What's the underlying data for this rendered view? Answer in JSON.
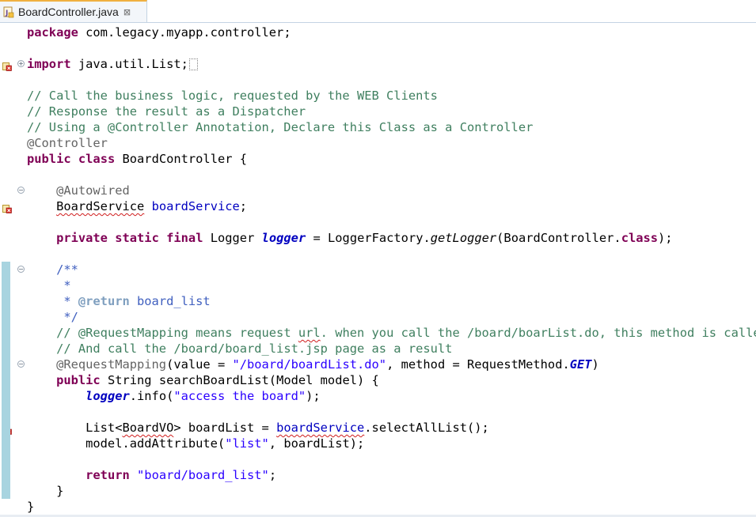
{
  "editor": {
    "tab": {
      "label": "BoardController.java",
      "close_glyph": "⊠",
      "icon": "java-file-warning-icon"
    },
    "lines": [
      {
        "tokens": [
          {
            "t": "package",
            "c": "kw"
          },
          {
            "t": " com.legacy.myapp.controller;"
          }
        ]
      },
      {
        "tokens": []
      },
      {
        "tokens": [
          {
            "t": "import",
            "c": "kw"
          },
          {
            "t": " java.util.List;"
          },
          {
            "folded": true
          }
        ],
        "fold": "+",
        "marker": "warning"
      },
      {
        "tokens": []
      },
      {
        "tokens": [
          {
            "t": "// Call the business logic, requested by the WEB Clients",
            "c": "cm"
          }
        ]
      },
      {
        "tokens": [
          {
            "t": "// Response the result as a Dispatcher",
            "c": "cm"
          }
        ]
      },
      {
        "tokens": [
          {
            "t": "// Using a @Controller Annotation, Declare this Class as a Controller",
            "c": "cm"
          }
        ]
      },
      {
        "tokens": [
          {
            "t": "@Controller",
            "c": "an"
          }
        ]
      },
      {
        "tokens": [
          {
            "t": "public",
            "c": "kw"
          },
          {
            "t": " "
          },
          {
            "t": "class",
            "c": "kw"
          },
          {
            "t": " BoardController {"
          }
        ]
      },
      {
        "tokens": []
      },
      {
        "tokens": [
          {
            "t": "    "
          },
          {
            "t": "@Autowired",
            "c": "an"
          }
        ],
        "fold": "-"
      },
      {
        "tokens": [
          {
            "t": "    "
          },
          {
            "t": "BoardService",
            "c": "squig"
          },
          {
            "t": " "
          },
          {
            "t": "boardService",
            "c": "fld"
          },
          {
            "t": ";"
          }
        ],
        "marker": "error"
      },
      {
        "tokens": []
      },
      {
        "tokens": [
          {
            "t": "    "
          },
          {
            "t": "private",
            "c": "kw"
          },
          {
            "t": " "
          },
          {
            "t": "static",
            "c": "kw"
          },
          {
            "t": " "
          },
          {
            "t": "final",
            "c": "kw"
          },
          {
            "t": " Logger "
          },
          {
            "t": "logger",
            "c": "sfld"
          },
          {
            "t": " = LoggerFactory."
          },
          {
            "t": "getLogger",
            "c": "smeth"
          },
          {
            "t": "(BoardController."
          },
          {
            "t": "class",
            "c": "kw"
          },
          {
            "t": ");"
          }
        ]
      },
      {
        "tokens": []
      },
      {
        "tokens": [
          {
            "t": "    "
          },
          {
            "t": "/**",
            "c": "jd"
          }
        ],
        "fold": "-"
      },
      {
        "tokens": [
          {
            "t": "     *",
            "c": "jd"
          }
        ]
      },
      {
        "tokens": [
          {
            "t": "     * ",
            "c": "jd"
          },
          {
            "t": "@return",
            "c": "jdtag"
          },
          {
            "t": " board_list",
            "c": "jd"
          }
        ]
      },
      {
        "tokens": [
          {
            "t": "     */",
            "c": "jd"
          }
        ]
      },
      {
        "tokens": [
          {
            "t": "    "
          },
          {
            "t": "// @RequestMapping means request ",
            "c": "cm"
          },
          {
            "t": "url",
            "c": "cm squig"
          },
          {
            "t": ". when you call the /board/boarList.do, this method is called",
            "c": "cm"
          }
        ]
      },
      {
        "tokens": [
          {
            "t": "    "
          },
          {
            "t": "// And call the /board/board_list.jsp page as a result",
            "c": "cm"
          }
        ]
      },
      {
        "tokens": [
          {
            "t": "    "
          },
          {
            "t": "@RequestMapping",
            "c": "an"
          },
          {
            "t": "(value = "
          },
          {
            "t": "\"/board/boardList.do\"",
            "c": "str"
          },
          {
            "t": ", method = RequestMethod."
          },
          {
            "t": "GET",
            "c": "sfld"
          },
          {
            "t": ")"
          }
        ],
        "fold": "-"
      },
      {
        "tokens": [
          {
            "t": "    "
          },
          {
            "t": "public",
            "c": "kw"
          },
          {
            "t": " String searchBoardList(Model model) {"
          }
        ]
      },
      {
        "tokens": [
          {
            "t": "        "
          },
          {
            "t": "logger",
            "c": "sfld"
          },
          {
            "t": ".info("
          },
          {
            "t": "\"access the board\"",
            "c": "str"
          },
          {
            "t": ");"
          }
        ]
      },
      {
        "tokens": []
      },
      {
        "tokens": [
          {
            "t": "        List<"
          },
          {
            "t": "BoardVO",
            "c": "squig"
          },
          {
            "t": "> boardList = "
          },
          {
            "t": "boardService",
            "c": "fld squig"
          },
          {
            "t": ".selectAllList();"
          }
        ],
        "marker": "error"
      },
      {
        "tokens": [
          {
            "t": "        model.addAttribute("
          },
          {
            "t": "\"list\"",
            "c": "str"
          },
          {
            "t": ", boardList);"
          }
        ]
      },
      {
        "tokens": []
      },
      {
        "tokens": [
          {
            "t": "        "
          },
          {
            "t": "return",
            "c": "kw"
          },
          {
            "t": " "
          },
          {
            "t": "\"board/board_list\"",
            "c": "str"
          },
          {
            "t": ";"
          }
        ]
      },
      {
        "tokens": [
          {
            "t": "    }"
          }
        ]
      },
      {
        "tokens": [
          {
            "t": "}"
          }
        ]
      }
    ],
    "colors": {
      "keyword": "#7f0055",
      "comment": "#3f7f5f",
      "javadoc": "#3f5fbf",
      "annotation": "#646464",
      "string": "#2a00ff",
      "field": "#0000c0",
      "change_bar": "#a8d4e0"
    }
  }
}
